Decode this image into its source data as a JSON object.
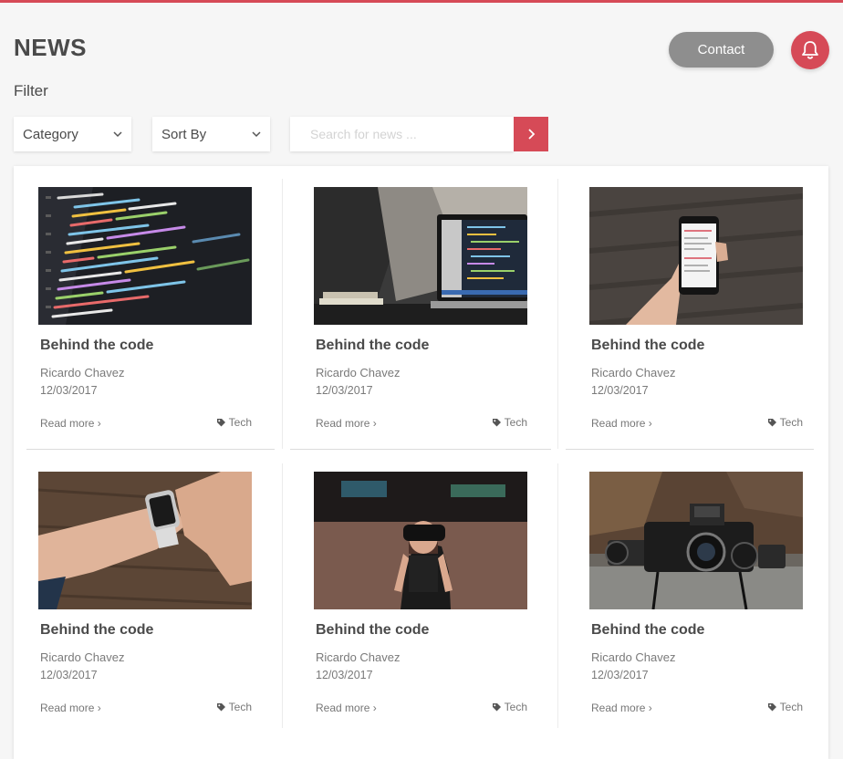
{
  "header": {
    "title": "NEWS",
    "contact_label": "Contact",
    "bell_icon": "bell-icon",
    "accent_color": "#d64a57"
  },
  "filter": {
    "label": "Filter",
    "category": {
      "value": "Category",
      "icon": "chevron-down-icon"
    },
    "sort": {
      "value": "Sort By",
      "icon": "chevron-down-icon"
    },
    "search": {
      "placeholder": "Search for news ...",
      "value": "",
      "button_icon": "chevron-right-icon"
    }
  },
  "articles": [
    {
      "image": "code-on-screen",
      "title": "Behind the code",
      "author": "Ricardo Chavez",
      "date": "12/03/2017",
      "read_more": "Read more ›",
      "tag": "Tech",
      "tag_icon": "tag-icon"
    },
    {
      "image": "laptop-on-desk",
      "title": "Behind the code",
      "author": "Ricardo Chavez",
      "date": "12/03/2017",
      "read_more": "Read more ›",
      "tag": "Tech",
      "tag_icon": "tag-icon"
    },
    {
      "image": "hand-holding-phone",
      "title": "Behind the code",
      "author": "Ricardo Chavez",
      "date": "12/03/2017",
      "read_more": "Read more ›",
      "tag": "Tech",
      "tag_icon": "tag-icon"
    },
    {
      "image": "smartwatch-on-wrist",
      "title": "Behind the code",
      "author": "Ricardo Chavez",
      "date": "12/03/2017",
      "read_more": "Read more ›",
      "tag": "Tech",
      "tag_icon": "tag-icon"
    },
    {
      "image": "person-in-vr-headset",
      "title": "Behind the code",
      "author": "Ricardo Chavez",
      "date": "12/03/2017",
      "read_more": "Read more ›",
      "tag": "Tech",
      "tag_icon": "tag-icon"
    },
    {
      "image": "camera-on-log",
      "title": "Behind the code",
      "author": "Ricardo Chavez",
      "date": "12/03/2017",
      "read_more": "Read more ›",
      "tag": "Tech",
      "tag_icon": "tag-icon"
    }
  ]
}
